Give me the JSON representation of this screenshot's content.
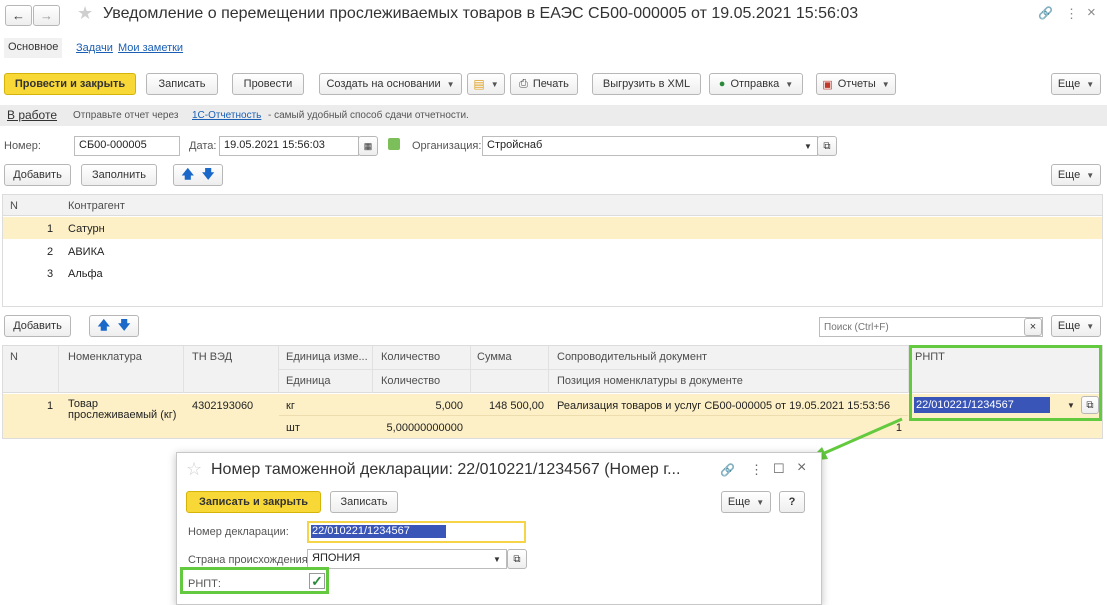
{
  "window": {
    "title": "Уведомление о перемещении прослеживаемых товаров в ЕАЭС СБ00-000005 от 19.05.2021 15:56:03",
    "nav_back": "←",
    "nav_forward": "→",
    "star": "★",
    "link_icon": "🔗",
    "more_icon": "⋮",
    "close_icon": "×"
  },
  "tabs": [
    "Основное",
    "Задачи",
    "Мои заметки"
  ],
  "toolbar": {
    "post_close": "Провести и закрыть",
    "write": "Записать",
    "post": "Провести",
    "create_based": "Создать на основании",
    "print": "Печать",
    "export_xml": "Выгрузить в XML",
    "send": "Отправка",
    "reports": "Отчеты",
    "more": "Еще"
  },
  "info_bar": {
    "status": "В работе",
    "text_before": "Отправьте отчет через",
    "link": "1С-Отчетность",
    "text_after": "- самый удобный способ сдачи отчетности."
  },
  "header_fields": {
    "number_label": "Номер:",
    "number_value": "СБ00-000005",
    "date_label": "Дата:",
    "date_value": "19.05.2021 15:56:03",
    "org_label": "Организация:",
    "org_value": "Стройснаб"
  },
  "contractors": {
    "add": "Добавить",
    "fill": "Заполнить",
    "more": "Еще",
    "columns": [
      "N",
      "Контрагент"
    ],
    "rows": [
      {
        "n": "1",
        "name": "Сатурн"
      },
      {
        "n": "2",
        "name": "АВИКА"
      },
      {
        "n": "3",
        "name": "Альфа"
      }
    ]
  },
  "goods": {
    "add": "Добавить",
    "search_placeholder": "Поиск (Ctrl+F)",
    "clear": "×",
    "more": "Еще",
    "columns": {
      "n": "N",
      "nomenclature": "Номенклатура",
      "tnved": "ТН ВЭД",
      "unit": "Единица изме...",
      "unit_sub": "Единица",
      "qty": "Количество",
      "qty_sub": "Количество",
      "sum": "Сумма",
      "doc": "Сопроводительный документ",
      "doc_sub": "Позиция номенклатуры в документе",
      "rnpt": "РНПТ"
    },
    "row": {
      "n": "1",
      "nomenclature_1": "Товар",
      "nomenclature_2": "прослеживаемый (кг)",
      "tnved": "4302193060",
      "unit": "кг",
      "unit_sub": "шт",
      "qty": "5,000",
      "qty_sub": "5,00000000000",
      "sum": "148 500,00",
      "doc": "Реализация товаров и услуг СБ00-000005 от 19.05.2021 15:53:56",
      "doc_sub": "1",
      "rnpt": "22/010221/1234567"
    }
  },
  "dialog": {
    "title": "Номер таможенной декларации: 22/010221/1234567 (Номер г...",
    "save_close": "Записать и закрыть",
    "save": "Записать",
    "more": "Еще",
    "help": "?",
    "decl_label": "Номер декларации:",
    "decl_value": "22/010221/1234567",
    "country_label": "Страна происхождения:",
    "country_value": "ЯПОНИЯ",
    "rnpt_label": "РНПТ:",
    "rnpt_checked": true
  },
  "colors": {
    "accent_yellow": "#f8d836",
    "selected_row": "#fdf0c6",
    "highlight_frame": "#63c93e",
    "selection_blue": "#3a55b8"
  }
}
